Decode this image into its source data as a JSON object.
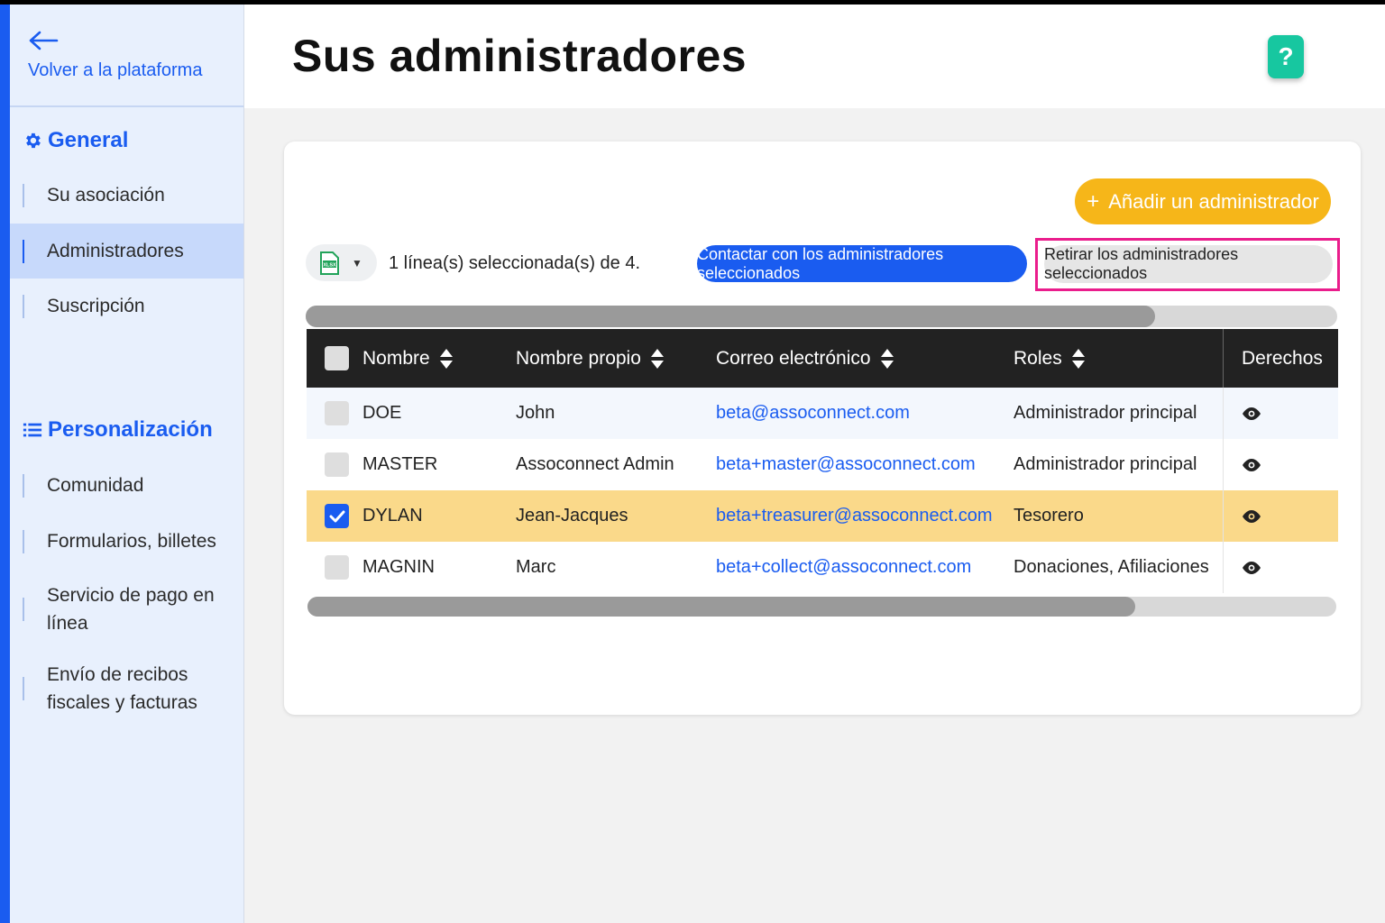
{
  "sidebar": {
    "back_label": "Volver a la plataforma",
    "sections": [
      {
        "title": "General",
        "icon": "gear-icon",
        "items": [
          {
            "label": "Su asociación",
            "active": false
          },
          {
            "label": "Administradores",
            "active": true
          },
          {
            "label": "Suscripción",
            "active": false
          }
        ]
      },
      {
        "title": "Personalización",
        "icon": "list-icon",
        "items": [
          {
            "label": "Comunidad",
            "active": false
          },
          {
            "label": "Formularios, billetes",
            "active": false
          },
          {
            "label": "Servicio de pago en línea",
            "active": false
          },
          {
            "label": "Envío de recibos fiscales y facturas",
            "active": false
          }
        ]
      }
    ]
  },
  "header": {
    "title": "Sus administradores",
    "help_label": "?"
  },
  "toolbar": {
    "add_label": "Añadir un administrador",
    "add_icon": "+",
    "export_icon": "xlsx-file-icon",
    "selection_text": "1 línea(s) seleccionada(s) de 4.",
    "contact_label": "Contactar con los administradores seleccionados",
    "remove_label": "Retirar los administradores seleccionados"
  },
  "table": {
    "columns": [
      "Nombre",
      "Nombre propio",
      "Correo electrónico",
      "Roles",
      "Derechos"
    ],
    "rows": [
      {
        "nombre": "DOE",
        "nombre_propio": "John",
        "email": "beta@assoconnect.com",
        "roles": "Administrador principal",
        "checked": false
      },
      {
        "nombre": "MASTER",
        "nombre_propio": "Assoconnect Admin",
        "email": "beta+master@assoconnect.com",
        "roles": "Administrador principal",
        "checked": false
      },
      {
        "nombre": "DYLAN",
        "nombre_propio": "Jean-Jacques",
        "email": "beta+treasurer@assoconnect.com",
        "roles": "Tesorero",
        "checked": true
      },
      {
        "nombre": "MAGNIN",
        "nombre_propio": "Marc",
        "email": "beta+collect@assoconnect.com",
        "roles": "Donaciones, Afiliaciones",
        "checked": false
      }
    ]
  },
  "colors": {
    "primary": "#1a5cf0",
    "accent": "#f6b619",
    "help": "#17c7a0",
    "highlight": "#ea1d8c",
    "selected_row": "#fad98a"
  }
}
